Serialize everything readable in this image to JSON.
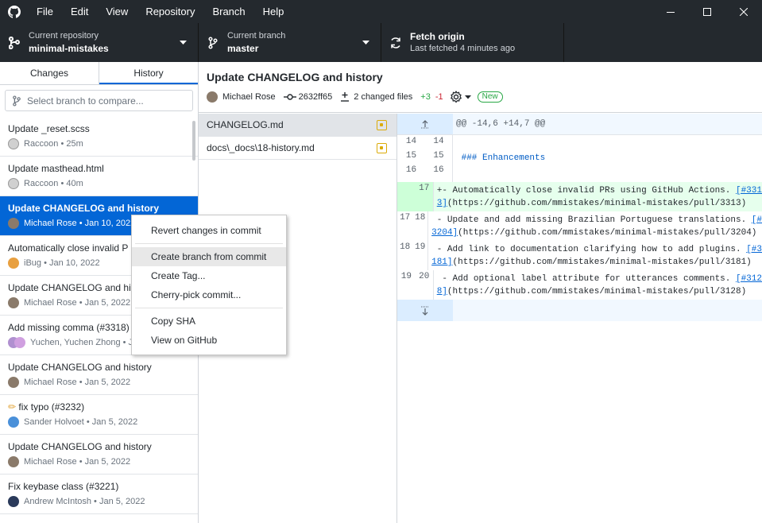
{
  "menu": [
    "File",
    "Edit",
    "View",
    "Repository",
    "Branch",
    "Help"
  ],
  "toolbar": {
    "repo_label": "Current repository",
    "repo_value": "minimal-mistakes",
    "branch_label": "Current branch",
    "branch_value": "master",
    "fetch_label": "Fetch origin",
    "fetch_sub": "Last fetched 4 minutes ago"
  },
  "sidebar": {
    "tab_changes": "Changes",
    "tab_history": "History",
    "compare_placeholder": "Select branch to compare..."
  },
  "commits": [
    {
      "title": "Update _reset.scss",
      "meta": "Raccoon • 25m"
    },
    {
      "title": "Update masthead.html",
      "meta": "Raccoon • 40m"
    },
    {
      "title": "Update CHANGELOG and history",
      "meta": "Michael Rose • Jan 10, 2022"
    },
    {
      "title": "Automatically close invalid P",
      "meta": "iBug • Jan 10, 2022"
    },
    {
      "title": "Update CHANGELOG and his",
      "meta": "Michael Rose • Jan 5, 2022"
    },
    {
      "title": "Add missing comma (#3318)",
      "meta": "Yuchen, Yuchen Zhong • Ja"
    },
    {
      "title": "Update CHANGELOG and history",
      "meta": "Michael Rose • Jan 5, 2022"
    },
    {
      "title": "fix typo (#3232)",
      "meta": "Sander Holvoet • Jan 5, 2022"
    },
    {
      "title": "Update CHANGELOG and history",
      "meta": "Michael Rose • Jan 5, 2022"
    },
    {
      "title": "Fix keybase class (#3221)",
      "meta": "Andrew McIntosh • Jan 5, 2022"
    }
  ],
  "commit_detail": {
    "title": "Update CHANGELOG and history",
    "author": "Michael Rose",
    "sha": "2632ff65",
    "files_changed": "2 changed files",
    "additions": "+3",
    "deletions": "-1",
    "badge": "New"
  },
  "files": [
    {
      "name": "CHANGELOG.md"
    },
    {
      "name": "docs\\_docs\\18-history.md"
    }
  ],
  "diff": {
    "hunk_header": "@@ -14,6 +14,7 @@",
    "lines": [
      {
        "old": "14",
        "new": "14",
        "text": ""
      },
      {
        "old": "15",
        "new": "15",
        "text": " ### Enhancements"
      },
      {
        "old": "16",
        "new": "16",
        "text": ""
      },
      {
        "old": "",
        "new": "17",
        "text_a": "+- Automatically close invalid PRs using GitHub Actions. ",
        "link_a": "[#331",
        "link_b": "3]",
        "text_b": "(https://github.com/mmistakes/minimal-mistakes/pull/3313)"
      },
      {
        "old": "17",
        "new": "18",
        "text_a": " - Update and add missing Brazilian Portuguese translations. ",
        "link_a": "[#",
        "link_b": "3204]",
        "text_b": "(https://github.com/mmistakes/minimal-mistakes/pull/3204)"
      },
      {
        "old": "18",
        "new": "19",
        "text_a": " - Add link to documentation clarifying how to add plugins. ",
        "link_a": "[#3",
        "link_b": "181]",
        "text_b": "(https://github.com/mmistakes/minimal-mistakes/pull/3181)"
      },
      {
        "old": "19",
        "new": "20",
        "text_a": " - Add optional label attribute for utterances comments. ",
        "link_a": "[#312",
        "link_b": "8]",
        "text_b": "(https://github.com/mmistakes/minimal-mistakes/pull/3128)"
      }
    ]
  },
  "context_menu": {
    "revert": "Revert changes in commit",
    "create_branch": "Create branch from commit",
    "create_tag": "Create Tag...",
    "cherry_pick": "Cherry-pick commit...",
    "copy_sha": "Copy SHA",
    "view_github": "View on GitHub"
  }
}
